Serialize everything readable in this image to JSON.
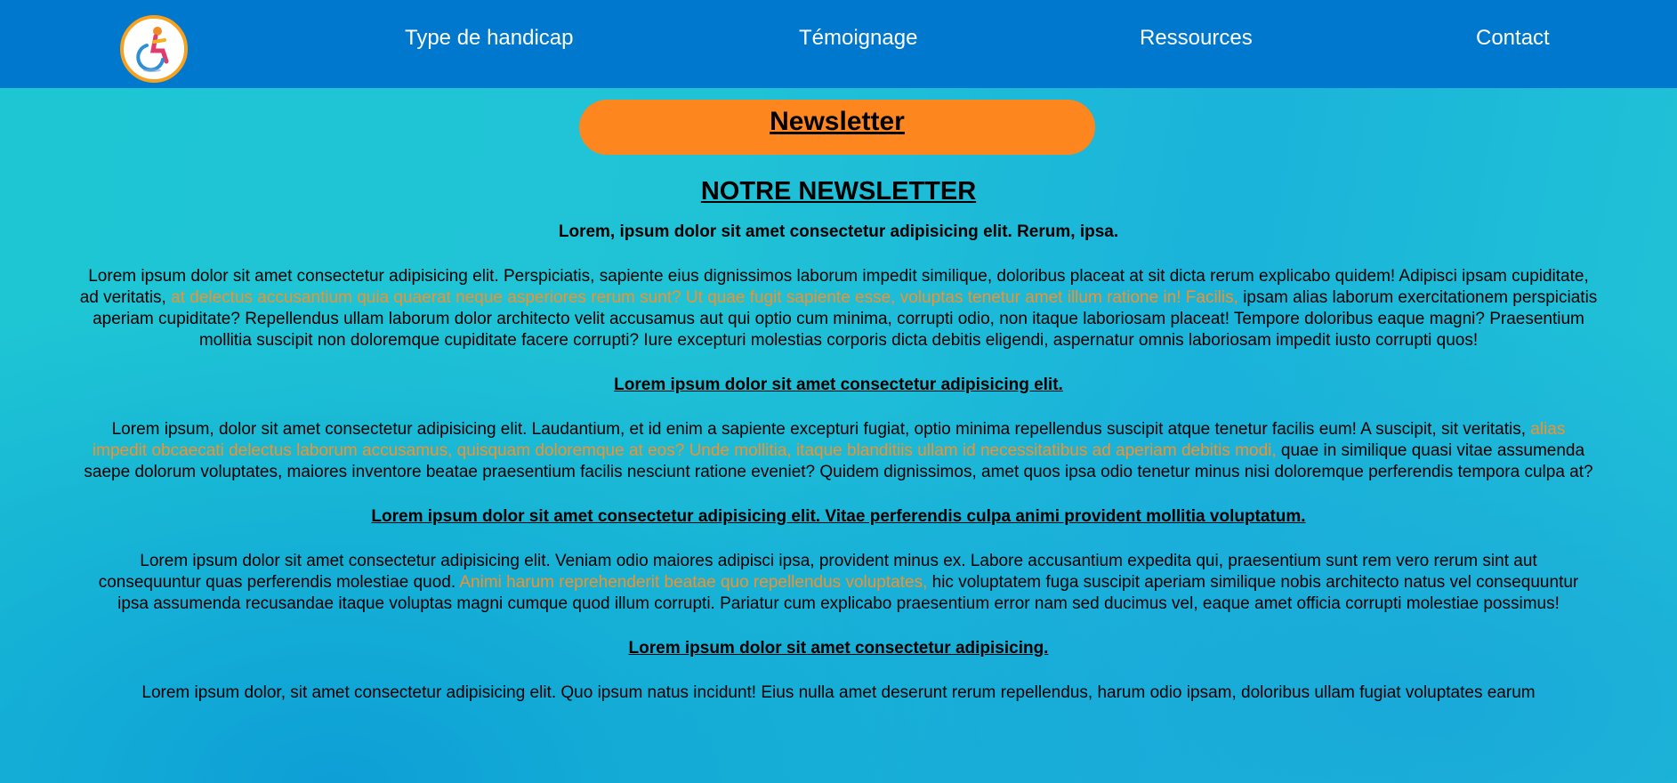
{
  "nav": {
    "logo_icon": "wheelchair-accessibility-logo",
    "items": [
      "Type de handicap",
      "Témoignage",
      "Ressources",
      "Contact"
    ]
  },
  "banner": {
    "label": "Newsletter"
  },
  "article": {
    "title": "NOTRE NEWSLETTER",
    "intro": "Lorem, ipsum dolor sit amet consectetur adipisicing elit. Rerum, ipsa.",
    "sections": [
      {
        "heading": "",
        "before": "Lorem ipsum dolor sit amet consectetur adipisicing elit. Perspiciatis, sapiente eius dignissimos laborum impedit similique, doloribus placeat at sit dicta rerum explicabo quidem! Adipisci ipsam cupiditate, ad veritatis,",
        "highlight": "at delectus accusantium quia quaerat neque asperiores rerum sunt? Ut quae fugit sapiente esse, voluptas tenetur amet illum ratione in! Facilis,",
        "after": "ipsam alias laborum exercitationem perspiciatis aperiam cupiditate? Repellendus ullam laborum dolor architecto velit accusamus aut qui optio cum minima, corrupti odio, non itaque laboriosam placeat! Tempore doloribus eaque magni? Praesentium mollitia suscipit non doloremque cupiditate facere corrupti? Iure excepturi molestias corporis dicta debitis eligendi, aspernatur omnis laboriosam impedit iusto corrupti quos!"
      },
      {
        "heading": "Lorem ipsum dolor sit amet consectetur adipisicing elit.",
        "before": "Lorem ipsum, dolor sit amet consectetur adipisicing elit. Laudantium, et id enim a sapiente excepturi fugiat, optio minima repellendus suscipit atque tenetur facilis eum! A suscipit, sit veritatis,",
        "highlight": "alias impedit obcaecati delectus laborum accusamus, quisquam doloremque at eos? Unde mollitia, itaque blanditiis ullam id necessitatibus ad aperiam debitis modi,",
        "after": "quae in similique quasi vitae assumenda saepe dolorum voluptates, maiores inventore beatae praesentium facilis nesciunt ratione eveniet? Quidem dignissimos, amet quos ipsa odio tenetur minus nisi doloremque perferendis tempora culpa at?"
      },
      {
        "heading": "Lorem ipsum dolor sit amet consectetur adipisicing elit. Vitae perferendis culpa animi provident mollitia voluptatum.",
        "before": "Lorem ipsum dolor sit amet consectetur adipisicing elit. Veniam odio maiores adipisci ipsa, provident minus ex. Labore accusantium expedita qui, praesentium sunt rem vero rerum sint aut consequuntur quas perferendis molestiae quod.",
        "highlight": "Animi harum reprehenderit beatae quo repellendus voluptates,",
        "after": "hic voluptatem fuga suscipit aperiam similique nobis architecto natus vel consequuntur ipsa assumenda recusandae itaque voluptas magni cumque quod illum corrupti. Pariatur cum explicabo praesentium error nam sed ducimus vel, eaque amet officia corrupti molestiae possimus!"
      },
      {
        "heading": "Lorem ipsum dolor sit amet consectetur adipisicing.",
        "before": "Lorem ipsum dolor, sit amet consectetur adipisicing elit. Quo ipsum natus incidunt! Eius nulla amet deserunt rerum repellendus, harum odio ipsam, doloribus ullam fugiat voluptates earum",
        "highlight": "",
        "after": ""
      }
    ]
  },
  "colors": {
    "nav_bg": "#0078cd",
    "banner_bg": "#fd861e",
    "highlight_text": "#f5902a",
    "logo_ring": "#f7a11e"
  }
}
